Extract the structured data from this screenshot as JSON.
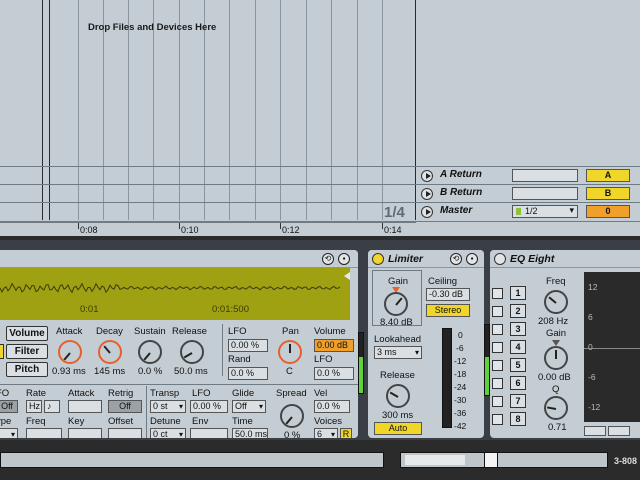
{
  "arrangement": {
    "drop_text": "Drop Files and Devices Here",
    "page_counter": "1/4",
    "ruler_labels": [
      "0:08",
      "0:10",
      "0:12",
      "0:14"
    ],
    "tracks": [
      {
        "name": "A Return",
        "tag": "A"
      },
      {
        "name": "B Return",
        "tag": "B"
      },
      {
        "name": "Master",
        "tag": "0",
        "selector": "1/2"
      }
    ]
  },
  "sampler": {
    "wave_markers": [
      "0:01",
      "0:01:500"
    ],
    "volume_btn": "Volume",
    "filter_btn": "Filter",
    "pitch_btn": "Pitch",
    "env": {
      "attack_label": "Attack",
      "attack_value": "0.93 ms",
      "decay_label": "Decay",
      "decay_value": "145 ms",
      "sustain_label": "Sustain",
      "sustain_value": "0.0 %",
      "release_label": "Release",
      "release_value": "50.0 ms"
    },
    "lfo_label": "LFO",
    "lfo_value": "0.00 %",
    "rand_label": "Rand",
    "rand_value": "0.0 %",
    "pan_label": "Pan",
    "pan_value": "C",
    "volume_label": "Volume",
    "volume_value": "0.00 dB",
    "lfo2_label": "LFO",
    "lfo2_value": "0.0 %",
    "row2": {
      "fo_label": "FO",
      "rate_label": "Rate",
      "attack_label": "Attack",
      "retrig_label": "Retrig",
      "off_value": "Off",
      "hz_value": "Hz",
      "note_value": "♪",
      "retrig_value": "Off",
      "ype_label": "ype",
      "freq_label": "Freq",
      "key_label": "Key",
      "offset_label": "Offset"
    },
    "transp_label": "Transp",
    "transp_value": "0 st",
    "lfo3_label": "LFO",
    "lfo3_value": "0.00 %",
    "detune_label": "Detune",
    "detune_value": "0 ct",
    "env_label": "Env",
    "glide_label": "Glide",
    "glide_value": "Off",
    "time_label": "Time",
    "time_value": "50.0 ms",
    "spread_label": "Spread",
    "spread_value": "0 %",
    "vel_label": "Vel",
    "vel_value": "0.0 %",
    "voices_label": "Voices",
    "voices_value": "6",
    "r_value": "R"
  },
  "limiter": {
    "title": "Limiter",
    "gain_label": "Gain",
    "gain_value": "8.40 dB",
    "ceiling_label": "Ceiling",
    "ceiling_value": "-0.30 dB",
    "stereo_btn": "Stereo",
    "lookahead_label": "Lookahead",
    "lookahead_value": "3 ms",
    "release_label": "Release",
    "release_value": "300 ms",
    "auto_btn": "Auto",
    "meter_scale": [
      "0",
      "-6",
      "-12",
      "-18",
      "-24",
      "-30",
      "-36",
      "-42"
    ]
  },
  "eq": {
    "title": "EQ Eight",
    "bands": [
      "1",
      "2",
      "3",
      "4",
      "5",
      "6",
      "7",
      "8"
    ],
    "freq_label": "Freq",
    "freq_value": "208 Hz",
    "gain_label": "Gain",
    "gain_value": "0.00 dB",
    "q_label": "Q",
    "q_value": "0.71",
    "display_scale": [
      "12",
      "6",
      "0",
      "-6",
      "-12"
    ]
  },
  "bottom": {
    "cpu_label": "3-808"
  }
}
